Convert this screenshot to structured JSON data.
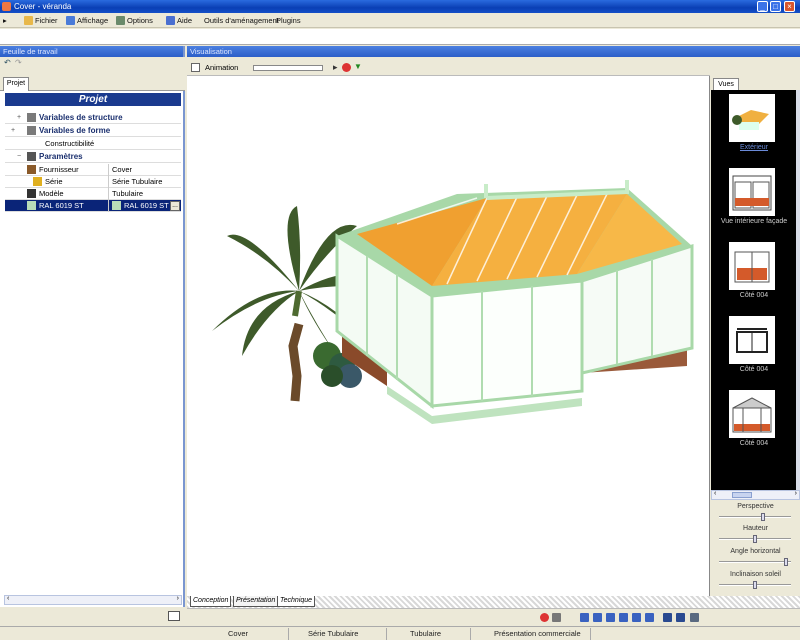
{
  "window": {
    "title": "Cover - véranda"
  },
  "menu": [
    {
      "label": "Fichier",
      "color": "#e8b84a"
    },
    {
      "label": "Affichage",
      "color": "#4a7bd8"
    },
    {
      "label": "Options",
      "color": "#6a8a6a"
    },
    {
      "label": "Aide",
      "color": "#4a6fd0"
    },
    {
      "label": "Outils d'aménagement",
      "color": ""
    },
    {
      "label": "Plugins",
      "color": ""
    }
  ],
  "left_panel": {
    "header": "Feuille de travail",
    "tab": "Projet",
    "project_title": "Projet",
    "tree": [
      {
        "label": "Variables de structure",
        "value": "",
        "bold": true,
        "expander": "+",
        "icon_color": "#7a7a7a"
      },
      {
        "label": "Variables de forme",
        "value": "",
        "bold": true,
        "expander": "+",
        "icon_color": "#7a7a7a"
      },
      {
        "label": "Constructibilité",
        "value": "",
        "bold": false,
        "expander": "",
        "icon_color": ""
      },
      {
        "label": "Paramètres",
        "value": "",
        "bold": true,
        "expander": "-",
        "icon_color": "#555555"
      },
      {
        "label": "Fournisseur",
        "value": "Cover",
        "bold": false,
        "expander": "",
        "icon_color": "#8a5a2a"
      },
      {
        "label": "Série",
        "value": "Série Tubulaire",
        "bold": false,
        "expander": "",
        "icon_color": "#e0b020"
      },
      {
        "label": "Modèle",
        "value": "Tubulaire",
        "bold": false,
        "expander": "",
        "icon_color": "#333333"
      },
      {
        "label": "RAL 6019 ST",
        "value": "RAL 6019 ST",
        "bold": false,
        "expander": "",
        "icon_color": "#b8dcb8",
        "selected": true
      }
    ],
    "more_button": "..."
  },
  "center": {
    "header": "Visualisation",
    "toolbar_label": "Animation",
    "tabs": [
      "Conception",
      "Présentation",
      "Technique"
    ]
  },
  "gallery": {
    "tab": "Vues",
    "items": [
      {
        "label": "Extérieur"
      },
      {
        "label": "Vue intérieure façade"
      },
      {
        "label": "Côté 004"
      },
      {
        "label": "Côté 004"
      },
      {
        "label": "Côté 004"
      }
    ],
    "sliders": [
      {
        "label": "Perspective",
        "level": 0.62
      },
      {
        "label": "Hauteur",
        "level": 0.5
      },
      {
        "label": "Angle horizontal",
        "level": 0.95
      },
      {
        "label": "Inclinaison soleil",
        "level": 0.5
      }
    ]
  },
  "status": [
    "Cover",
    "Série Tubulaire",
    "Tubulaire",
    "Présentation commerciale"
  ]
}
